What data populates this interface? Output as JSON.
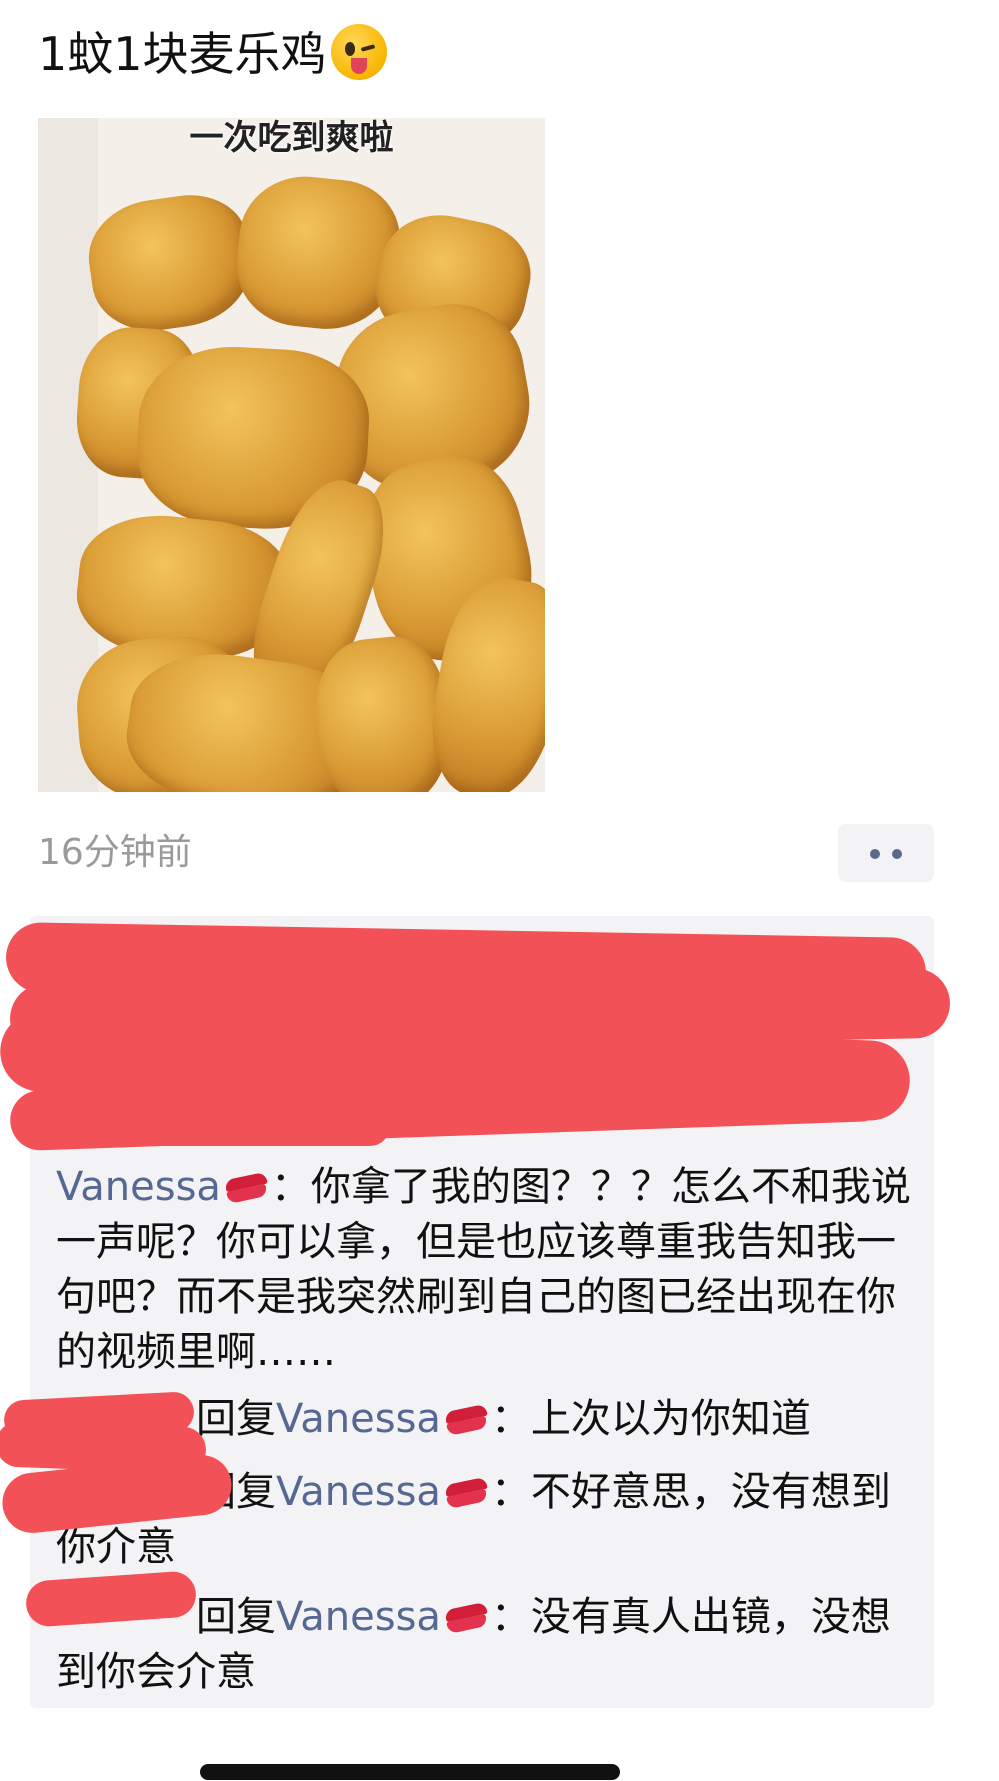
{
  "post": {
    "text": "1蚊1块麦乐鸡",
    "emoji": "winking-face-with-tongue",
    "image": {
      "overlay_text": "一次吃到爽啦"
    },
    "timestamp": "16分钟前"
  },
  "colors": {
    "name": "#556892",
    "timestamp": "#9a9a9a",
    "comments_bg": "#f3f3f5",
    "redaction": "#f25257"
  },
  "comments": [
    {
      "author": "Vanessa",
      "author_emoji": "kiss-mark",
      "text": "：你拿了我的图？？？怎么不和我说一声呢？你可以拿，但是也应该尊重我告知我一句吧？而不是我突然刷到自己的图已经出现在你的视频里啊……"
    },
    {
      "reply_word": "回复",
      "reply_to": "Vanessa",
      "reply_to_emoji": "kiss-mark",
      "text": "：上次以为你知道"
    },
    {
      "reply_word": "回复",
      "reply_to": "Vanessa",
      "reply_to_emoji": "kiss-mark",
      "text": "：不好意思，没有想到你介意"
    },
    {
      "reply_word": "回复",
      "reply_to": "Vanessa",
      "reply_to_emoji": "kiss-mark",
      "text": "：没有真人出镜，没想到你会介意"
    }
  ]
}
